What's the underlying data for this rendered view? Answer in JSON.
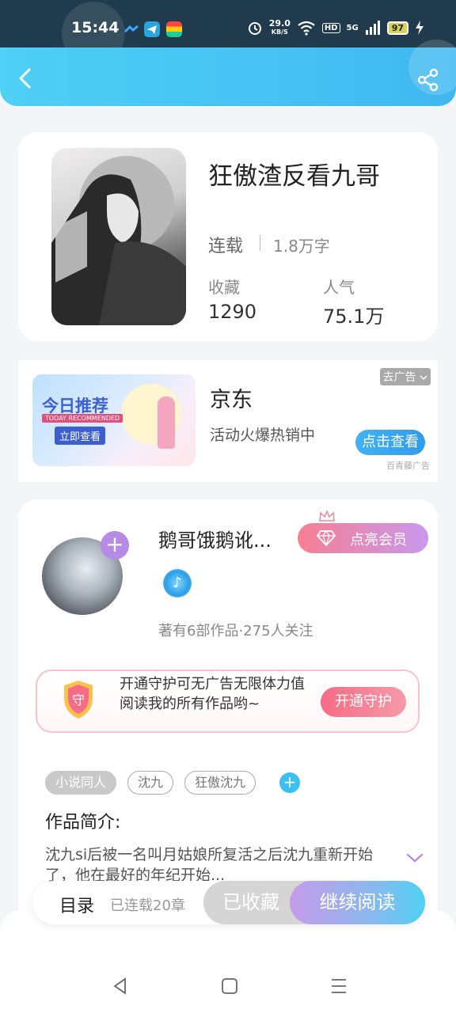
{
  "status_bar": {
    "time": "15:44",
    "net_speed_value": "29.0",
    "net_speed_unit": "KB/S",
    "hd": "HD",
    "signal": "5G",
    "battery": "97"
  },
  "header": {
    "back_icon": "chevron-left-icon",
    "share_icon": "share-icon"
  },
  "book": {
    "title": "狂傲渣反看九哥",
    "status": "连载",
    "word_count": "1.8万字",
    "favorites_label": "收藏",
    "favorites_value": "1290",
    "popularity_label": "人气",
    "popularity_value": "75.1万"
  },
  "ad": {
    "image_title": "今日推荐",
    "image_subtitle": "TODAY RECOMMENDED",
    "image_button": "立即查看",
    "remove_label": "去广告",
    "title": "京东",
    "description": "活动火爆热销中",
    "cta": "点击查看",
    "source": "百青藤广告"
  },
  "author": {
    "name": "鹅哥饿鹅讹...",
    "vip_button": "点亮会员",
    "stats": "著有6部作品·275人关注",
    "guard_text": "开通守护可无广告无限体力值阅读我的所有作品哟~",
    "guard_shield_char": "守",
    "guard_button": "开通守护"
  },
  "tags": [
    "小说同人",
    "沈九",
    "狂傲沈九"
  ],
  "intro": {
    "title": "作品简介:",
    "text": "沈九si后被一名叫月姑娘所复活之后沈九重新开始了，他在最好的年纪开始..."
  },
  "action_bar": {
    "toc": "目录",
    "chapters": "已连载20章",
    "collected": "已收藏",
    "continue": "继续阅读"
  },
  "colors": {
    "header_accent": "#3fb8f1",
    "vip_gradient_start": "#f77f92",
    "vip_gradient_end": "#c998ee",
    "guard_button": "#f66b86"
  }
}
